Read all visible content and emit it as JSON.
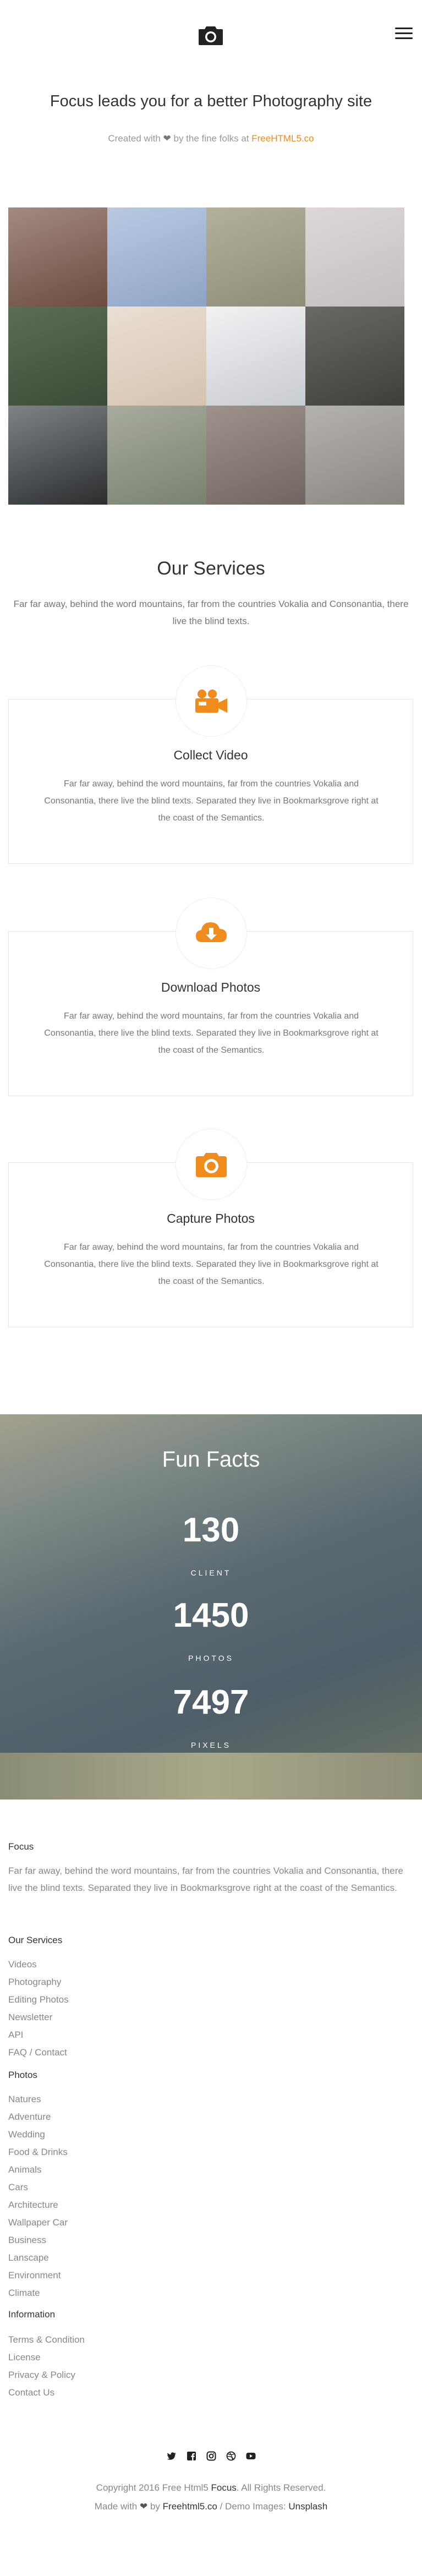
{
  "header": {
    "logo_icon": "camera-icon",
    "menu_icon": "hamburger-menu-icon"
  },
  "hero": {
    "title": "Focus leads you for a better Photography site",
    "credit_prefix": "Created with",
    "credit_icon": "heart-icon",
    "credit_middle": "by the fine folks at",
    "credit_link": "FreeHTML5.co"
  },
  "gallery": {
    "tile_colors": [
      [
        "#a38a80",
        "#6b4c3f"
      ],
      [
        "#b9c9e3",
        "#8ea4c4"
      ],
      [
        "#b3b09b",
        "#8f8c78"
      ],
      [
        "#ddd8d8",
        "#c4bfbf"
      ],
      [
        "#5b6f55",
        "#3c4a37"
      ],
      [
        "#eadfd4",
        "#d6c3b0"
      ],
      [
        "#f1f2f4",
        "#c8cbd0"
      ],
      [
        "#6a6962",
        "#3f3f3a"
      ],
      [
        "#7e8386",
        "#2b2d2f"
      ],
      [
        "#a7ac9c",
        "#7a8170"
      ],
      [
        "#9e938c",
        "#706560"
      ],
      [
        "#b5b2ad",
        "#8a8783"
      ]
    ]
  },
  "services": {
    "title": "Our Services",
    "intro": "Far far away, behind the word mountains, far from the countries Vokalia and Consonantia, there live the blind texts.",
    "accent": "#f08b1c",
    "items": [
      {
        "icon": "video-camera-icon",
        "title": "Collect Video",
        "text": "Far far away, behind the word mountains, far from the countries Vokalia and Consonantia, there live the blind texts. Separated they live in Bookmarksgrove right at the coast of the Semantics."
      },
      {
        "icon": "cloud-download-icon",
        "title": "Download Photos",
        "text": "Far far away, behind the word mountains, far from the countries Vokalia and Consonantia, there live the blind texts. Separated they live in Bookmarksgrove right at the coast of the Semantics."
      },
      {
        "icon": "camera-icon",
        "title": "Capture Photos",
        "text": "Far far away, behind the word mountains, far from the countries Vokalia and Consonantia, there live the blind texts. Separated they live in Bookmarksgrove right at the coast of the Semantics."
      }
    ]
  },
  "facts": {
    "title": "Fun Facts",
    "items": [
      {
        "number": "130",
        "label": "CLIENT"
      },
      {
        "number": "1450",
        "label": "PHOTOS"
      },
      {
        "number": "7497",
        "label": "PIXELS"
      }
    ]
  },
  "footer": {
    "brand": "Focus",
    "about": "Far far away, behind the word mountains, far from the countries Vokalia and Consonantia, there live the blind texts. Separated they live in Bookmarksgrove right at the coast of the Semantics.",
    "services_heading": "Our Services",
    "services_links": [
      "Videos",
      "Photography",
      "Editing Photos",
      "Newsletter",
      "API",
      "FAQ / Contact"
    ],
    "photos_heading": "Photos",
    "photos_links": [
      "Natures",
      "Adventure",
      "Wedding",
      "Food & Drinks",
      "Animals",
      "Cars",
      "Architecture",
      "Wallpaper Car",
      "Business",
      "Lanscape",
      "Environment",
      "Climate"
    ],
    "info_heading": "Information",
    "info_links": [
      "Terms & Condition",
      "License",
      "Privacy & Policy",
      "Contact Us"
    ],
    "social_icons": [
      "twitter-icon",
      "facebook-icon",
      "instagram-icon",
      "dribbble-icon",
      "youtube-icon"
    ],
    "copyright_prefix": "Copyright 2016 Free Html5",
    "copyright_brand": "Focus",
    "copyright_suffix": ". All Rights Reserved.",
    "made_prefix": "Made with",
    "made_middle": "by",
    "made_link": "Freehtml5.co",
    "made_sep": "/ Demo Images:",
    "made_images": "Unsplash"
  }
}
